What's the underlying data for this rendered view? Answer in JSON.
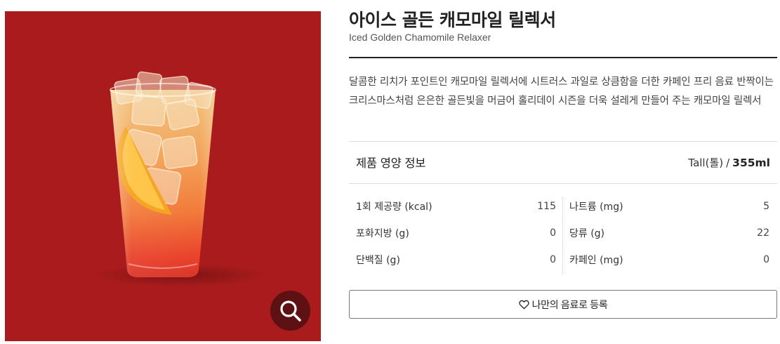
{
  "product": {
    "name_ko": "아이스 골든 캐모마일 릴렉서",
    "name_en": "Iced Golden Chamomile Relaxer",
    "description": "달콤한 리치가 포인트인 캐모마일 릴렉서에 시트러스 과일로 상큼함을 더한 카페인 프리 음료 반짝이는 크리스마스처럼 은은한 골든빛을 머금어 홀리데이 시즌을 더욱 설레게 만들어 주는 캐모마일 릴렉서"
  },
  "photo": {
    "background_color": "#a91b1c",
    "zoom_icon": "magnifier-icon"
  },
  "nutrition": {
    "title": "제품 영양 정보",
    "size_label": "Tall(톨)",
    "size_separator": "/",
    "size_volume": "355ml",
    "left": [
      {
        "label": "1회 제공량 (kcal)",
        "value": "115"
      },
      {
        "label": "포화지방 (g)",
        "value": "0"
      },
      {
        "label": "단백질 (g)",
        "value": "0"
      }
    ],
    "right": [
      {
        "label": "나트륨 (mg)",
        "value": "5"
      },
      {
        "label": "당류 (g)",
        "value": "22"
      },
      {
        "label": "카페인 (mg)",
        "value": "0"
      }
    ]
  },
  "favorite": {
    "icon": "heart-outline-icon",
    "label": "나만의 음료로 등록"
  }
}
